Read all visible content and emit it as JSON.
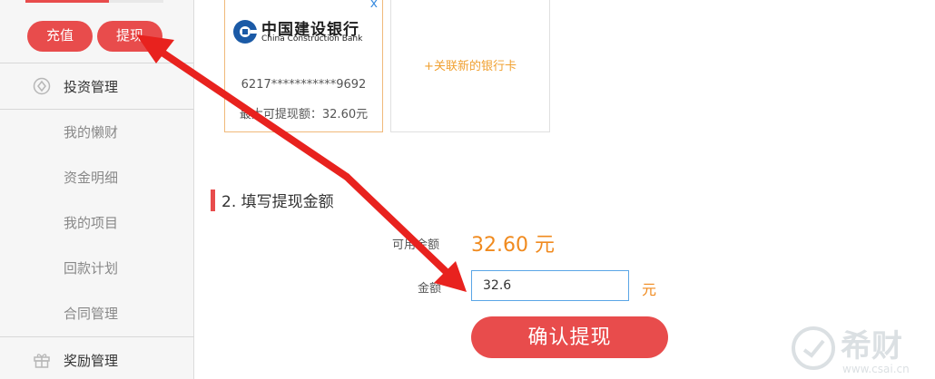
{
  "sidebar": {
    "recharge_label": "充值",
    "withdraw_label": "提现",
    "groups": [
      {
        "label": "投资管理",
        "icon": "coin-icon"
      },
      {
        "label": "奖励管理",
        "icon": "gift-icon"
      }
    ],
    "sub_items": [
      "我的懒财",
      "资金明细",
      "我的项目",
      "回款计划",
      "合同管理"
    ]
  },
  "bank_card": {
    "close": "x",
    "bank_name_cn": "中国建设银行",
    "bank_name_en": "China Construction Bank",
    "card_number": "6217***********9692",
    "max_withdraw": "最大可提现额：32.60元"
  },
  "add_card": {
    "label": "+关联新的银行卡"
  },
  "step": {
    "title": "2. 填写提现金额"
  },
  "form": {
    "balance_label": "可用余额",
    "balance_value": "32.60 元",
    "amount_label": "金额",
    "amount_value": "32.6",
    "unit": "元",
    "confirm_label": "确认提现"
  },
  "watermark": {
    "brand": "希财",
    "url": "www.csai.cn"
  },
  "colors": {
    "accent": "#e84c4c",
    "orange": "#f08a1e",
    "input_border": "#5aa6e6"
  }
}
